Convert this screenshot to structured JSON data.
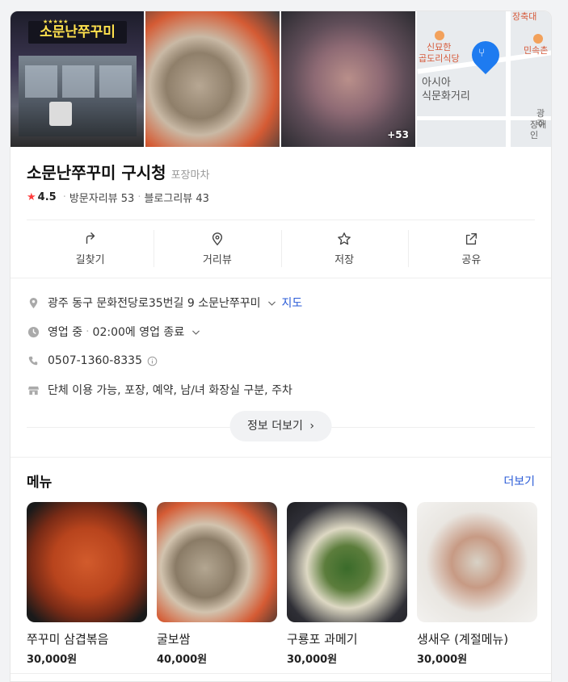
{
  "photos": {
    "sign_text": "소문난쭈꾸미",
    "more_count": "+53",
    "map_labels": [
      "장축대",
      "신묘한",
      "곱도리식당",
      "민속촌",
      "아시아",
      "식문화거리",
      "광주",
      "장애인"
    ]
  },
  "place": {
    "name": "소문난쭈꾸미 구시청",
    "category": "포장마차",
    "rating": "4.5",
    "visitor_reviews": "방문자리뷰 53",
    "blog_reviews": "블로그리뷰 43"
  },
  "actions": [
    {
      "label": "길찾기",
      "icon": "directions-icon"
    },
    {
      "label": "거리뷰",
      "icon": "streetview-icon"
    },
    {
      "label": "저장",
      "icon": "star-icon"
    },
    {
      "label": "공유",
      "icon": "share-icon"
    }
  ],
  "details": {
    "address": "광주 동구 문화전당로35번길 9 소문난쭈꾸미",
    "map_link": "지도",
    "status": "영업 중",
    "hours": "02:00에 영업 종료",
    "phone": "0507-1360-8335",
    "facilities": "단체 이용 가능, 포장, 예약, 남/녀 화장실 구분, 주차",
    "more_info": "정보 더보기"
  },
  "menu": {
    "title": "메뉴",
    "more": "더보기",
    "items": [
      {
        "name": "쭈꾸미 삼겹볶음",
        "price": "30,000원"
      },
      {
        "name": "굴보쌈",
        "price": "40,000원"
      },
      {
        "name": "구룡포 과메기",
        "price": "30,000원"
      },
      {
        "name": "생새우 (계절메뉴)",
        "price": "30,000원"
      }
    ]
  },
  "colors": {
    "accent_blue": "#2a5bd7",
    "rating_star": "#ff3d3d",
    "map_pin": "#1e7bf0"
  }
}
